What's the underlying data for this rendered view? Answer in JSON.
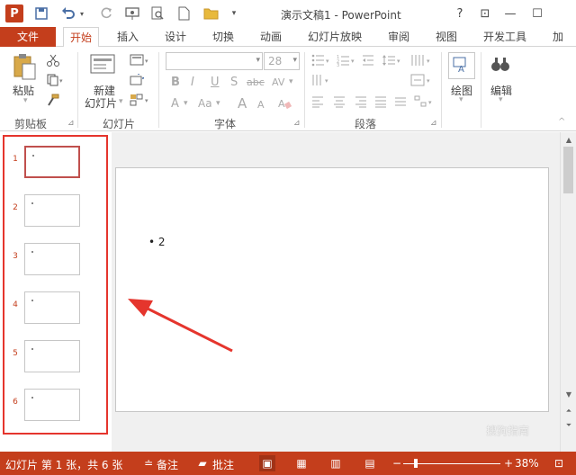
{
  "app": {
    "logo": "P",
    "title": "演示文稿1 - PowerPoint"
  },
  "quick_access": [
    "save-icon",
    "undo-icon",
    "redo-icon",
    "present-icon",
    "print-preview-icon",
    "new-icon",
    "open-icon",
    "customize-icon"
  ],
  "window_controls": {
    "help": "?",
    "restore_ribbon": "⊡",
    "minimize": "—",
    "maximize": "☐"
  },
  "tabs": {
    "file": "文件",
    "home": "开始",
    "insert": "插入",
    "design": "设计",
    "transitions": "切换",
    "animations": "动画",
    "slideshow": "幻灯片放映",
    "review": "审阅",
    "view": "视图",
    "developer": "开发工具",
    "addins": "加"
  },
  "ribbon": {
    "clipboard": {
      "label": "剪贴板",
      "paste": "粘贴"
    },
    "slides": {
      "label": "幻灯片",
      "new_slide_line1": "新建",
      "new_slide_line2": "幻灯片"
    },
    "font": {
      "label": "字体",
      "font_size": "28",
      "bold": "B",
      "italic": "I",
      "underline": "U",
      "shadow": "S",
      "strike": "abc",
      "spacing": "AV",
      "color": "A",
      "case": "Aa",
      "grow": "A",
      "shrink": "A"
    },
    "paragraph": {
      "label": "段落"
    },
    "drawing": {
      "label": "绘图"
    },
    "editing": {
      "label": "编辑"
    }
  },
  "thumbnails": {
    "items": [
      {
        "num": "1",
        "selected": true
      },
      {
        "num": "2",
        "selected": false
      },
      {
        "num": "3",
        "selected": false
      },
      {
        "num": "4",
        "selected": false
      },
      {
        "num": "5",
        "selected": false
      },
      {
        "num": "6",
        "selected": false
      }
    ]
  },
  "slide": {
    "bullet": "•",
    "text": "2"
  },
  "status": {
    "slide_info": "幻灯片 第 1 张，共 6 张",
    "notes": "备注",
    "comments": "批注",
    "zoom_out": "−",
    "zoom_in": "+",
    "zoom": "38%"
  },
  "watermark": "搜狗指南",
  "colors": {
    "accent": "#c43e1c",
    "highlight": "#e5352d"
  }
}
